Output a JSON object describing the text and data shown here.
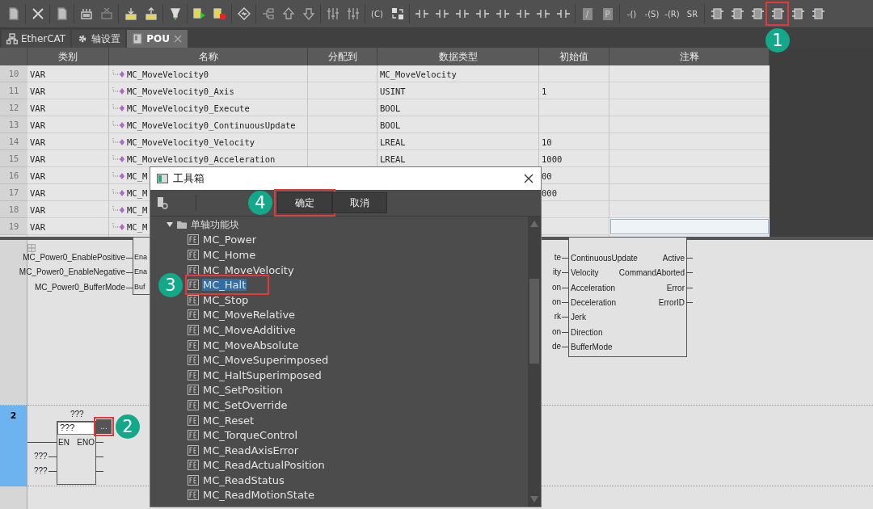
{
  "toolbar": {
    "groups": [
      {
        "items": [
          {
            "kind": "file"
          }
        ]
      },
      {
        "items": [
          {
            "kind": "close"
          }
        ]
      },
      {
        "items": [
          {
            "kind": "file"
          }
        ]
      },
      {
        "items": [
          {
            "kind": "grid"
          },
          {
            "kind": "grid-del"
          }
        ]
      },
      {
        "items": [
          {
            "kind": "import"
          },
          {
            "kind": "export"
          }
        ]
      },
      {
        "items": [
          {
            "kind": "probe"
          }
        ]
      },
      {
        "items": [
          {
            "kind": "run"
          },
          {
            "kind": "stop"
          }
        ]
      },
      {
        "items": [
          {
            "kind": "sync"
          }
        ]
      },
      {
        "items": [
          {
            "kind": "branch"
          },
          {
            "kind": "up"
          },
          {
            "kind": "down"
          }
        ]
      },
      {
        "items": [
          {
            "kind": "sliders"
          },
          {
            "kind": "sliders"
          }
        ]
      },
      {
        "items": [
          {
            "kind": "text",
            "text": "(C)"
          },
          {
            "kind": "swap"
          }
        ]
      },
      {
        "items": [
          {
            "kind": "contact"
          },
          {
            "kind": "contact"
          },
          {
            "kind": "contact"
          },
          {
            "kind": "contact"
          },
          {
            "kind": "contact"
          },
          {
            "kind": "contact"
          },
          {
            "kind": "contact"
          },
          {
            "kind": "contact"
          }
        ]
      },
      {
        "items": [
          {
            "kind": "square",
            "text": "/"
          },
          {
            "kind": "square",
            "text": "P"
          }
        ]
      },
      {
        "items": [
          {
            "kind": "text",
            "text": "-()"
          },
          {
            "kind": "text",
            "text": "-(S)"
          },
          {
            "kind": "text",
            "text": "-(R)"
          },
          {
            "kind": "text",
            "text": "SR"
          }
        ]
      },
      {
        "items": [
          {
            "kind": "block"
          },
          {
            "kind": "block"
          },
          {
            "kind": "block"
          },
          {
            "kind": "block",
            "callout": "1"
          },
          {
            "kind": "block"
          },
          {
            "kind": "block"
          }
        ]
      }
    ]
  },
  "tabs": [
    {
      "label": "EtherCAT",
      "kind": "network",
      "selected": false,
      "closable": false
    },
    {
      "label": "轴设置",
      "kind": "gear",
      "selected": false,
      "closable": false
    },
    {
      "label": "POU",
      "kind": "pou",
      "selected": true,
      "closable": true
    }
  ],
  "table": {
    "columns": [
      "类别",
      "名称",
      "分配到",
      "数据类型",
      "初始值",
      "注释"
    ],
    "rows": [
      {
        "no": "10",
        "category": "VAR",
        "name": "MC_MoveVelocity0",
        "type": "MC_MoveVelocity",
        "selected": false
      },
      {
        "no": "11",
        "category": "VAR",
        "name": "MC_MoveVelocity0_Axis",
        "type": "USINT",
        "init": "1",
        "selected": false
      },
      {
        "no": "12",
        "category": "VAR",
        "name": "MC_MoveVelocity0_Execute",
        "type": "BOOL",
        "selected": false
      },
      {
        "no": "13",
        "category": "VAR",
        "name": "MC_MoveVelocity0_ContinuousUpdate",
        "type": "BOOL",
        "selected": false
      },
      {
        "no": "14",
        "category": "VAR",
        "name": "MC_MoveVelocity0_Velocity",
        "type": "LREAL",
        "init": "10",
        "selected": false
      },
      {
        "no": "15",
        "category": "VAR",
        "name": "MC_MoveVelocity0_Acceleration",
        "type": "LREAL",
        "init": "1000",
        "selected": false
      },
      {
        "no": "16",
        "category": "VAR",
        "name": "MC_M",
        "init": "00",
        "selected": false
      },
      {
        "no": "17",
        "category": "VAR",
        "name": "MC_M",
        "init": "000",
        "selected": false
      },
      {
        "no": "18",
        "category": "VAR",
        "name": "MC_M",
        "selected": false
      },
      {
        "no": "19",
        "category": "VAR",
        "name": "MC_M",
        "selected": true
      }
    ]
  },
  "ladder": {
    "rung_1": {
      "left_inputs": [
        "MC_Power0_EnablePositive",
        "MC_Power0_EnableNegative",
        "MC_Power0_BufferMode"
      ],
      "left_block_pins": [
        "Ena",
        "Ena",
        "Buf"
      ],
      "right_block": {
        "wire_labels": [
          "te",
          "ity",
          "on",
          "on",
          "rk",
          "on",
          "de"
        ],
        "inputs": [
          "ContinuousUpdate",
          "Velocity",
          "Acceleration",
          "Deceleration",
          "Jerk",
          "Direction",
          "BufferMode"
        ],
        "outputs": [
          "Active",
          "CommandAborted",
          "Error",
          "ErrorID"
        ]
      }
    },
    "rung_2": {
      "number": "2",
      "title": "???",
      "instance": "???",
      "button": "...",
      "callout": "2",
      "en": "EN",
      "eno": "ENO",
      "inputs": [
        "???",
        "???"
      ]
    }
  },
  "dialog": {
    "title": "工具箱",
    "buttons": [
      {
        "label": "确定",
        "callout": "4"
      },
      {
        "label": "取消"
      }
    ],
    "tree": {
      "label": "单轴功能块",
      "expanded": true,
      "children": [
        {
          "label": "MC_Power",
          "selected": false
        },
        {
          "label": "MC_Home",
          "selected": false
        },
        {
          "label": "MC_MoveVelocity",
          "selected": false
        },
        {
          "label": "MC_Halt",
          "selected": true,
          "callout": "3"
        },
        {
          "label": "MC_Stop",
          "selected": false
        },
        {
          "label": "MC_MoveRelative",
          "selected": false
        },
        {
          "label": "MC_MoveAdditive",
          "selected": false
        },
        {
          "label": "MC_MoveAbsolute",
          "selected": false
        },
        {
          "label": "MC_MoveSuperimposed",
          "selected": false
        },
        {
          "label": "MC_HaltSuperimposed",
          "selected": false
        },
        {
          "label": "MC_SetPosition",
          "selected": false
        },
        {
          "label": "MC_SetOverride",
          "selected": false
        },
        {
          "label": "MC_Reset",
          "selected": false
        },
        {
          "label": "MC_TorqueControl",
          "selected": false
        },
        {
          "label": "MC_ReadAxisError",
          "selected": false
        },
        {
          "label": "MC_ReadActualPosition",
          "selected": false
        },
        {
          "label": "MC_ReadStatus",
          "selected": false
        },
        {
          "label": "MC_ReadMotionState",
          "selected": false
        }
      ]
    }
  }
}
